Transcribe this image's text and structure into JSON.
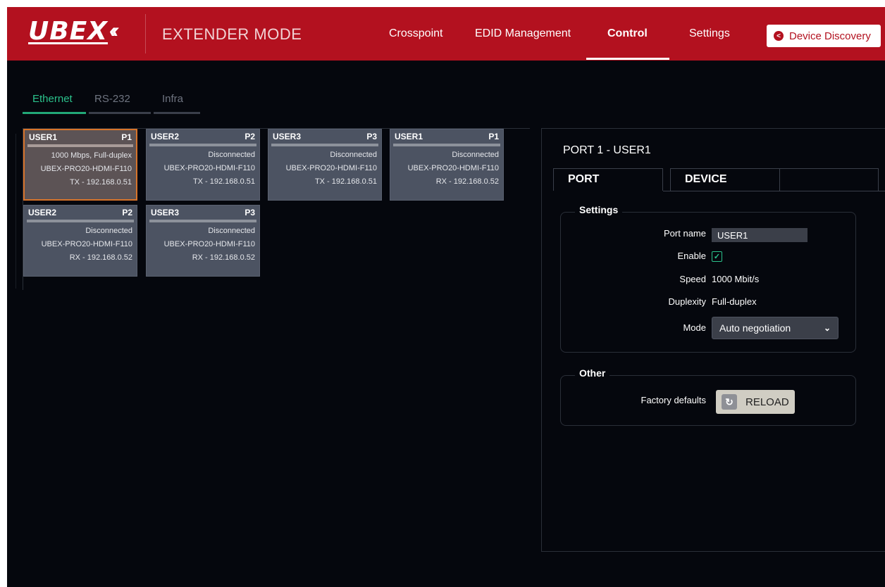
{
  "header": {
    "logo_text": "UBEX",
    "mode": "EXTENDER MODE",
    "nav": [
      "Crosspoint",
      "EDID Management",
      "Control",
      "Settings"
    ],
    "active_nav": "Control",
    "discovery_label": "Device Discovery",
    "accent_color": "#b3111f"
  },
  "tabs": [
    {
      "label": "Ethernet",
      "active": true
    },
    {
      "label": "RS-232",
      "active": false
    },
    {
      "label": "Infra",
      "active": false
    }
  ],
  "cards": [
    {
      "name": "USER1",
      "port": "P1",
      "status": "1000 Mbps, Full-duplex",
      "device": "UBEX-PRO20-HDMI-F110",
      "addr": "TX - 192.168.0.51",
      "selected": true
    },
    {
      "name": "USER2",
      "port": "P2",
      "status": "Disconnected",
      "device": "UBEX-PRO20-HDMI-F110",
      "addr": "TX - 192.168.0.51",
      "selected": false
    },
    {
      "name": "USER3",
      "port": "P3",
      "status": "Disconnected",
      "device": "UBEX-PRO20-HDMI-F110",
      "addr": "TX - 192.168.0.51",
      "selected": false
    },
    {
      "name": "USER1",
      "port": "P1",
      "status": "Disconnected",
      "device": "UBEX-PRO20-HDMI-F110",
      "addr": "RX - 192.168.0.52",
      "selected": false
    },
    {
      "name": "USER2",
      "port": "P2",
      "status": "Disconnected",
      "device": "UBEX-PRO20-HDMI-F110",
      "addr": "RX - 192.168.0.52",
      "selected": false
    },
    {
      "name": "USER3",
      "port": "P3",
      "status": "Disconnected",
      "device": "UBEX-PRO20-HDMI-F110",
      "addr": "RX - 192.168.0.52",
      "selected": false
    }
  ],
  "panel": {
    "title": "PORT 1 - USER1",
    "tab_port": "PORT",
    "tab_device": "DEVICE",
    "settings": {
      "legend": "Settings",
      "port_name_label": "Port name",
      "port_name_value": "USER1",
      "enable_label": "Enable",
      "enable_checked": true,
      "speed_label": "Speed",
      "speed_value": "1000 Mbit/s",
      "duplexity_label": "Duplexity",
      "duplexity_value": "Full-duplex",
      "mode_label": "Mode",
      "mode_value": "Auto negotiation"
    },
    "other": {
      "legend": "Other",
      "factory_label": "Factory defaults",
      "reload_label": "RELOAD"
    }
  },
  "icons": {
    "discovery": "chevron-left-circle-icon",
    "enable": "checkmark-icon",
    "mode": "chevron-down-icon",
    "reload": "reload-icon"
  }
}
